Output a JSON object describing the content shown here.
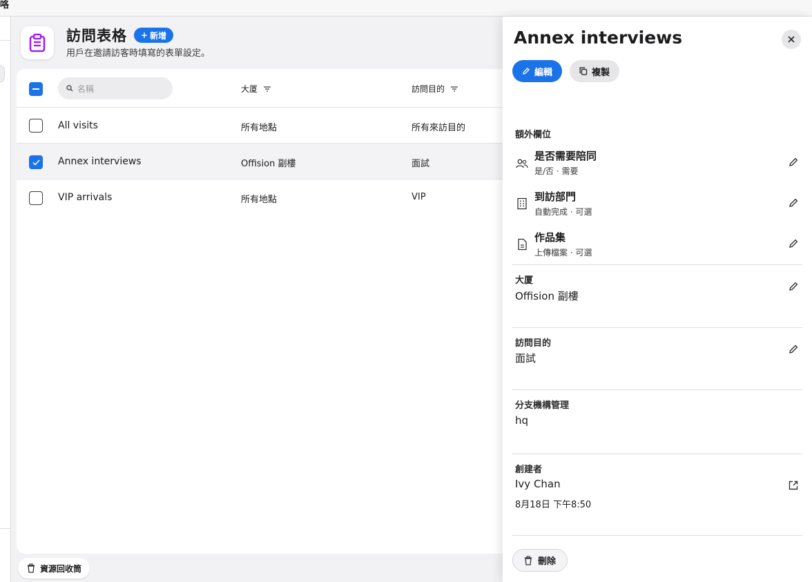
{
  "topbar": {
    "fragment": "咯"
  },
  "header": {
    "title": "訪問表格",
    "add_label": "新增",
    "subtitle": "用戶在邀請訪客時填寫的表單設定。"
  },
  "table": {
    "search_placeholder": "名稱",
    "columns": [
      "大厦",
      "訪問目的"
    ],
    "rows": [
      {
        "name": "All visits",
        "building": "所有地點",
        "purpose": "所有來訪目的",
        "checked": false
      },
      {
        "name": "Annex interviews",
        "building": "Offision 副樓",
        "purpose": "面試",
        "checked": true
      },
      {
        "name": "VIP arrivals",
        "building": "所有地點",
        "purpose": "VIP",
        "checked": false
      }
    ]
  },
  "trash_label": "資源回收筒",
  "panel": {
    "title": "Annex interviews",
    "edit_label": "編輯",
    "copy_label": "複製",
    "extra_fields_label": "額外欄位",
    "fields": [
      {
        "name": "是否需要陪同",
        "desc": "是/否 · 需要",
        "icon": "people-icon"
      },
      {
        "name": "到訪部門",
        "desc": "自動完成 · 可選",
        "icon": "building-icon"
      },
      {
        "name": "作品集",
        "desc": "上傳檔案 · 可選",
        "icon": "document-icon"
      }
    ],
    "building_label": "大厦",
    "building_value": "Offision 副樓",
    "purpose_label": "訪問目的",
    "purpose_value": "面試",
    "branch_label": "分支機構管理",
    "branch_value": "hq",
    "creator_label": "創建者",
    "creator_value": "Ivy Chan",
    "created_at": "8月18日 下午8:50",
    "delete_label": "刪除"
  },
  "colors": {
    "accent": "#1a73e8",
    "brand_icon": "#a020f0"
  }
}
